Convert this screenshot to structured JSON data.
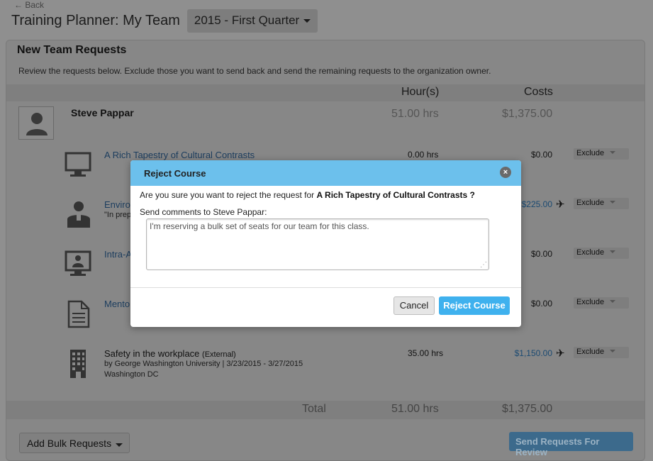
{
  "nav": {
    "back_label": "← Back"
  },
  "header": {
    "title": "Training Planner: My Team",
    "quarter": "2015 - First Quarter"
  },
  "panel": {
    "title": "New Team Requests",
    "description": "Review the requests below. Exclude those you want to send back and send the remaining requests to the organization owner.",
    "col_hours": "Hour(s)",
    "col_costs": "Costs"
  },
  "person": {
    "name": "Steve Pappar",
    "hours": "51.00 hrs",
    "costs": "$1,375.00"
  },
  "courses": [
    {
      "icon": "monitor-icon",
      "name": "A Rich Tapestry of Cultural Contrasts",
      "sub": "",
      "hours": "0.00 hrs",
      "cost": "$0.00",
      "exclude": "Exclude"
    },
    {
      "icon": "instructor-icon",
      "name": "Enviro",
      "sub": "\"In prep",
      "hours": "",
      "cost": "$225.00",
      "exclude": "Exclude"
    },
    {
      "icon": "virtual-classroom-icon",
      "name": "Intra-A",
      "sub": "",
      "hours": "",
      "cost": "$0.00",
      "exclude": "Exclude"
    },
    {
      "icon": "document-icon",
      "name": "Mento",
      "sub": "",
      "hours": "",
      "cost": "$0.00",
      "exclude": "Exclude"
    },
    {
      "icon": "building-icon",
      "name": "Safety in the workplace",
      "name_tag": "(External)",
      "sub": "by George Washington University  |  3/23/2015 - 3/27/2015",
      "sub2": "Washington DC",
      "hours": "35.00 hrs",
      "cost": "$1,150.00",
      "exclude": "Exclude"
    }
  ],
  "totals": {
    "label": "Total",
    "hours": "51.00 hrs",
    "costs": "$1,375.00"
  },
  "footer": {
    "bulk_label": "Add Bulk Requests",
    "send_label": "Send Requests For Review"
  },
  "modal": {
    "title": "Reject Course",
    "close_glyph": "×",
    "confirm_prefix": "Are you sure you want to reject the request for ",
    "confirm_course": "A Rich Tapestry of Cultural Contrasts ?",
    "comments_label": "Send comments to Steve Pappar:",
    "comments_value": "I'm reserving a bulk set of seats for our team for this class.",
    "cancel_label": "Cancel",
    "reject_label": "Reject Course"
  }
}
